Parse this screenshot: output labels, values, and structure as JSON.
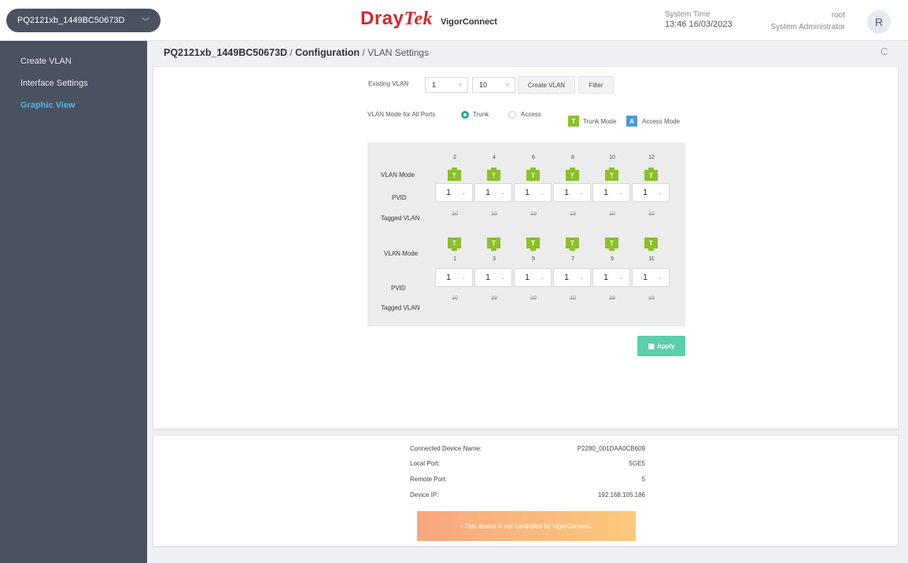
{
  "header": {
    "device_name": "PQ2121xb_1449BC50673D",
    "brand_dray": "Dray",
    "brand_tek": "Tek",
    "product": "VigorConnect",
    "system_time_label": "System Time",
    "system_time": "13:46 16/03/2023",
    "user_name": "root",
    "user_role": "System Administrator",
    "avatar_letter": "R",
    "dropdown_glyph": "﹀",
    "refresh_glyph": "C"
  },
  "sidebar": {
    "items": [
      {
        "label": "Create VLAN",
        "active": false
      },
      {
        "label": "Interface Settings",
        "active": false
      },
      {
        "label": "Graphic View",
        "active": true
      }
    ]
  },
  "breadcrumb": {
    "device": "PQ2121xb_1449BC50673D",
    "sep": "/",
    "section": "Configuration",
    "page": "VLAN Settings"
  },
  "filter": {
    "existing_vlan_label": "Existing VLAN",
    "from_value": "1",
    "to_value": "10",
    "clear_glyph": "×",
    "create_vlan_label": "Create VLAN",
    "filter_label": "Filter"
  },
  "mode": {
    "label": "VLAN Mode for All Ports",
    "trunk_label": "Trunk",
    "access_label": "Access",
    "selected": "Trunk",
    "legend_trunk_letter": "T",
    "legend_trunk_label": "Trunk Mode",
    "legend_access_letter": "A",
    "legend_access_label": "Access Mode",
    "trunk_color": "#8cbf2a",
    "access_color": "#4d9ad9"
  },
  "grid": {
    "vlan_mode_label": "VLAN Mode",
    "pvid_label": "PVID",
    "tagged_label": "Tagged VLAN",
    "icon_letter": "T",
    "dropdown_glyph": "⌄",
    "top_ports": [
      {
        "port": "2",
        "pvid": "1",
        "tagged": "10"
      },
      {
        "port": "4",
        "pvid": "1",
        "tagged": "10"
      },
      {
        "port": "6",
        "pvid": "1",
        "tagged": "10"
      },
      {
        "port": "8",
        "pvid": "1",
        "tagged": "10"
      },
      {
        "port": "10",
        "pvid": "1",
        "tagged": "10"
      },
      {
        "port": "12",
        "pvid": "1",
        "tagged": "10"
      }
    ],
    "bottom_ports": [
      {
        "port": "1",
        "pvid": "1",
        "tagged": "10"
      },
      {
        "port": "3",
        "pvid": "1",
        "tagged": "10"
      },
      {
        "port": "5",
        "pvid": "1",
        "tagged": "10"
      },
      {
        "port": "7",
        "pvid": "1",
        "tagged": "10"
      },
      {
        "port": "9",
        "pvid": "1",
        "tagged": "10"
      },
      {
        "port": "11",
        "pvid": "1",
        "tagged": "10"
      }
    ]
  },
  "apply_label": "Apply",
  "apply_color": "#5bcfa9",
  "info": {
    "connected_label": "Connected Device Name:",
    "connected_value": "P2280_001DAA0CB609",
    "local_port_label": "Local Port:",
    "local_port_value": "5GE5",
    "remote_port_label": "Remote Port:",
    "remote_port_value": "5",
    "device_ip_label": "Device IP:",
    "device_ip_value": "192.168.105.186",
    "warning_text": "•  This device is not controlled by VigorConnect."
  }
}
